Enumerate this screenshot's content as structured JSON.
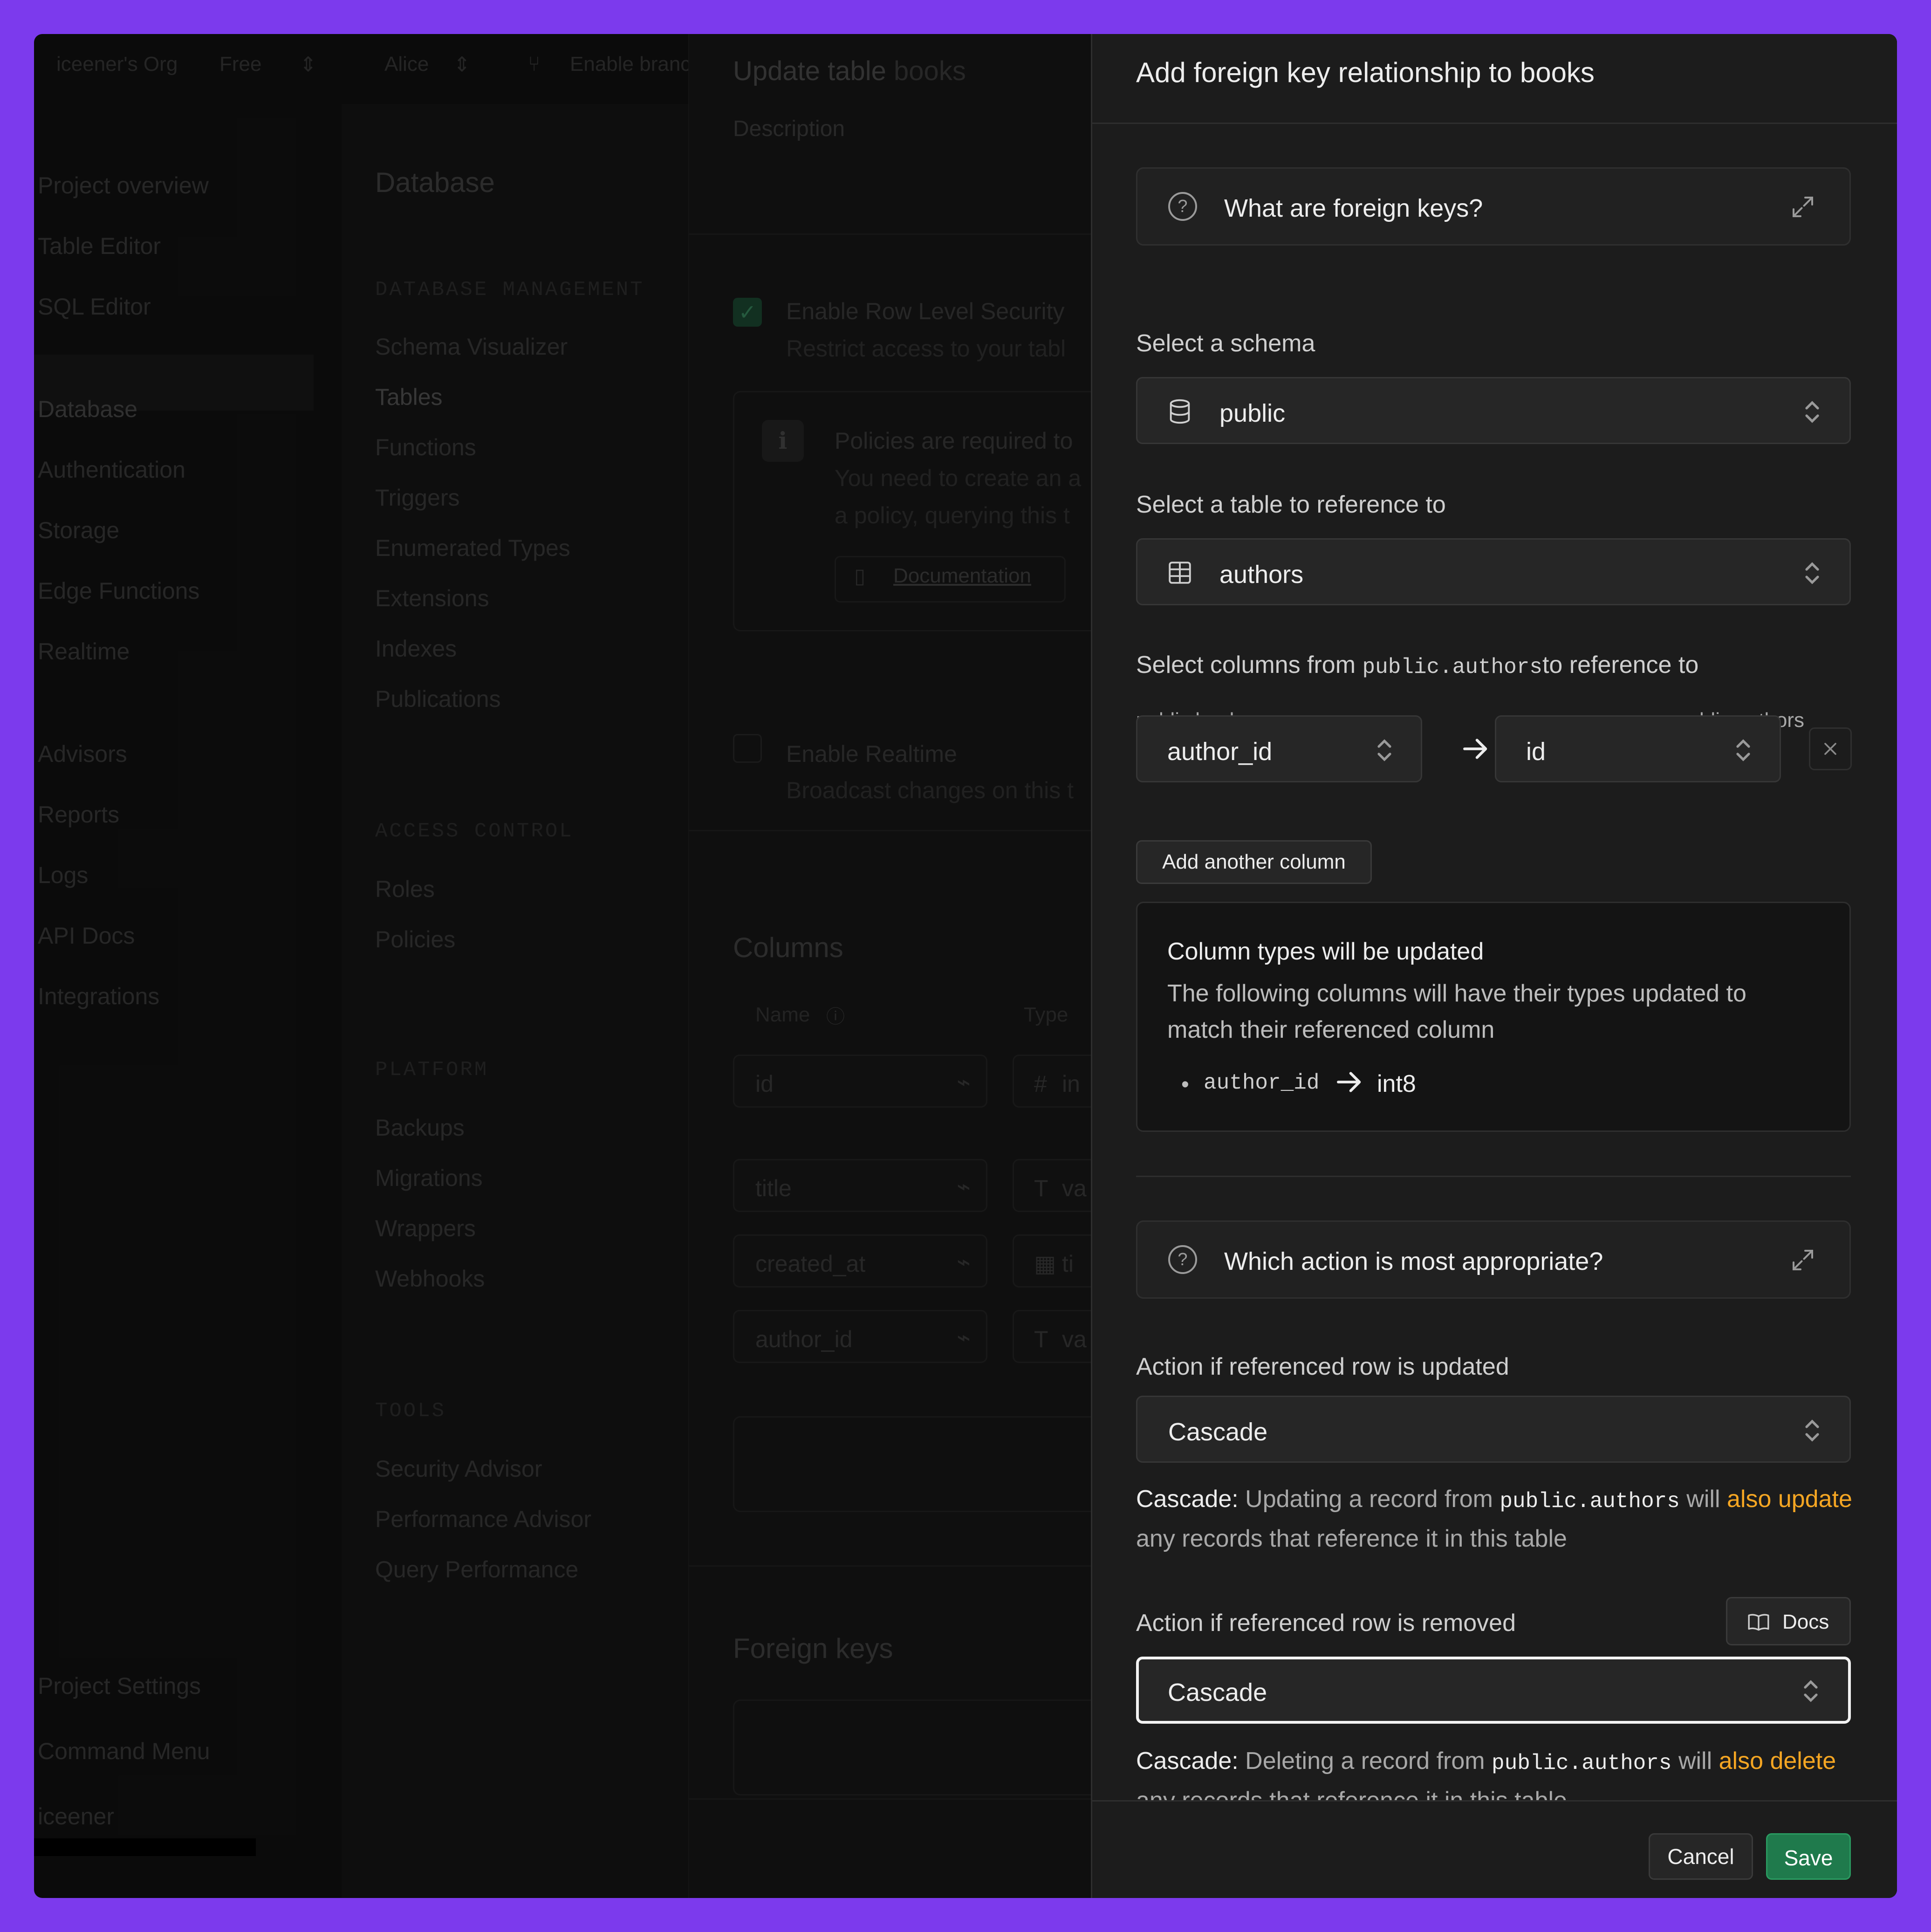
{
  "background_app": {
    "topbar": {
      "org": "iceener's Org",
      "plan": "Free",
      "project": "Alice",
      "branch": "Enable branc"
    },
    "nav": [
      "Project overview",
      "Table Editor",
      "SQL Editor",
      "Database",
      "Authentication",
      "Storage",
      "Edge Functions",
      "Realtime",
      "Advisors",
      "Reports",
      "Logs",
      "API Docs",
      "Integrations"
    ],
    "nav_bottom": [
      "Project Settings",
      "Command Menu",
      "iceener"
    ],
    "section_title": "Database",
    "submenu": {
      "database_management": {
        "heading": "DATABASE MANAGEMENT",
        "items": [
          "Schema Visualizer",
          "Tables",
          "Functions",
          "Triggers",
          "Enumerated Types",
          "Extensions",
          "Indexes",
          "Publications"
        ]
      },
      "access_control": {
        "heading": "ACCESS CONTROL",
        "items": [
          "Roles",
          "Policies"
        ]
      },
      "platform": {
        "heading": "PLATFORM",
        "items": [
          "Backups",
          "Migrations",
          "Wrappers",
          "Webhooks"
        ]
      },
      "tools": {
        "heading": "TOOLS",
        "items": [
          "Security Advisor",
          "Performance Advisor",
          "Query Performance"
        ]
      }
    },
    "update_table": {
      "title": "Update table",
      "table_name": "books",
      "description_label": "Description",
      "rls_title": "Enable Row Level Security",
      "rls_desc": "Restrict access to your tabl",
      "policy_title": "Policies are required to",
      "policy_line1": "You need to create an a",
      "policy_line2": "a policy, querying this t",
      "documentation": "Documentation",
      "realtime_title": "Enable Realtime",
      "realtime_desc": "Broadcast changes on this t",
      "columns_title": "Columns",
      "col_name_header": "Name",
      "col_type_header": "Type",
      "columns": [
        {
          "name": "id",
          "type_icon": "#",
          "type": "in"
        },
        {
          "name": "title",
          "type_icon": "T",
          "type": "va"
        },
        {
          "name": "created_at",
          "type_icon": "calendar",
          "type": "ti"
        },
        {
          "name": "author_id",
          "type_icon": "T",
          "type": "va"
        }
      ],
      "foreign_keys_title": "Foreign keys"
    }
  },
  "panel": {
    "title": "Add foreign key relationship to books",
    "faq_foreign_keys": "What are foreign keys?",
    "schema_label": "Select a schema",
    "schema_value": "public",
    "table_label": "Select a table to reference to",
    "table_value": "authors",
    "columns_label_prefix": "Select columns from ",
    "columns_label_code": "public.authors",
    "columns_label_suffix": "to reference to",
    "source_table": "public.books",
    "target_table": "public.authors",
    "source_column": "author_id",
    "target_column": "id",
    "add_column_button": "Add another column",
    "notice_title": "Column types will be updated",
    "notice_text_1": "The following columns will have their types updated to",
    "notice_text_2": "match their referenced column",
    "notice_column": "author_id",
    "notice_type": "int8",
    "faq_action": "Which action is most appropriate?",
    "update_label": "Action if referenced row is updated",
    "update_value": "Cascade",
    "update_desc": {
      "k": "Cascade:",
      "a": " Updating a record from ",
      "code": "public.authors",
      "b": " will ",
      "hl1": "also",
      "hl2": "update",
      "c": " any records that reference it in this table"
    },
    "remove_label": "Action if referenced row is removed",
    "docs_button": "Docs",
    "remove_value": "Cascade",
    "remove_desc": {
      "k": "Cascade:",
      "a": " Deleting a record from ",
      "code": "public.authors",
      "b": " will ",
      "hl1": "also",
      "hl2": "delete",
      "c": " any records that reference it in this table"
    },
    "cancel_button": "Cancel",
    "save_button": "Save"
  },
  "colors": {
    "accent_green": "#1f7a4c",
    "highlight": "#f5a623",
    "panel_bg": "#1c1c1c",
    "frame": "#7c3aed"
  }
}
